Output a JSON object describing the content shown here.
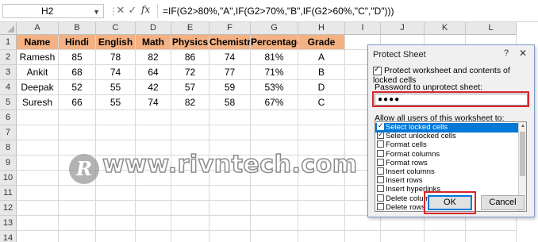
{
  "formula_bar": {
    "name_box": "H2",
    "cancel_symbol": "✕",
    "enter_symbol": "✓",
    "fx_label": "fx",
    "formula": "=IF(G2>80%,\"A\",IF(G2>70%,\"B\",IF(G2>60%,\"C\",\"D\")))"
  },
  "sheet": {
    "columns": [
      "A",
      "B",
      "C",
      "D",
      "E",
      "F",
      "G",
      "H",
      "I",
      "J",
      "K",
      "L"
    ],
    "row_numbers": [
      "1",
      "2",
      "3",
      "4",
      "5",
      "6",
      "7",
      "8",
      "9",
      "10",
      "11",
      "12",
      "13",
      "14"
    ],
    "header_row": [
      "Name",
      "Hindi",
      "English",
      "Math",
      "Physics",
      "Chemistry",
      "Percentage",
      "Grade"
    ],
    "rows": [
      [
        "Ramesh",
        "85",
        "78",
        "82",
        "86",
        "74",
        "81%",
        "A"
      ],
      [
        "Ankit",
        "68",
        "74",
        "64",
        "72",
        "77",
        "71%",
        "B"
      ],
      [
        "Deepak",
        "52",
        "55",
        "42",
        "57",
        "59",
        "53%",
        "D"
      ],
      [
        "Suresh",
        "66",
        "55",
        "74",
        "82",
        "58",
        "67%",
        "C"
      ]
    ],
    "header_fill": "#f4b183"
  },
  "watermark": {
    "logo_letter": "R",
    "text": "www.rivntech.com"
  },
  "dialog": {
    "title": "Protect Sheet",
    "help_symbol": "?",
    "close_symbol": "✕",
    "protect_checkbox_label": "Protect worksheet and contents of locked cells",
    "protect_checked": true,
    "password_label": "Password to unprotect sheet:",
    "password_value": "●●●●",
    "allow_label": "Allow all users of this worksheet to:",
    "permissions": [
      {
        "label": "Select locked cells",
        "checked": true,
        "selected": true
      },
      {
        "label": "Select unlocked cells",
        "checked": true,
        "selected": false
      },
      {
        "label": "Format cells",
        "checked": false,
        "selected": false
      },
      {
        "label": "Format columns",
        "checked": false,
        "selected": false
      },
      {
        "label": "Format rows",
        "checked": false,
        "selected": false
      },
      {
        "label": "Insert columns",
        "checked": false,
        "selected": false
      },
      {
        "label": "Insert rows",
        "checked": false,
        "selected": false
      },
      {
        "label": "Insert hyperlinks",
        "checked": false,
        "selected": false
      },
      {
        "label": "Delete columns",
        "checked": false,
        "selected": false
      },
      {
        "label": "Delete rows",
        "checked": false,
        "selected": false
      }
    ],
    "ok_label": "OK",
    "cancel_label": "Cancel",
    "highlight_color": "#d9262d"
  }
}
